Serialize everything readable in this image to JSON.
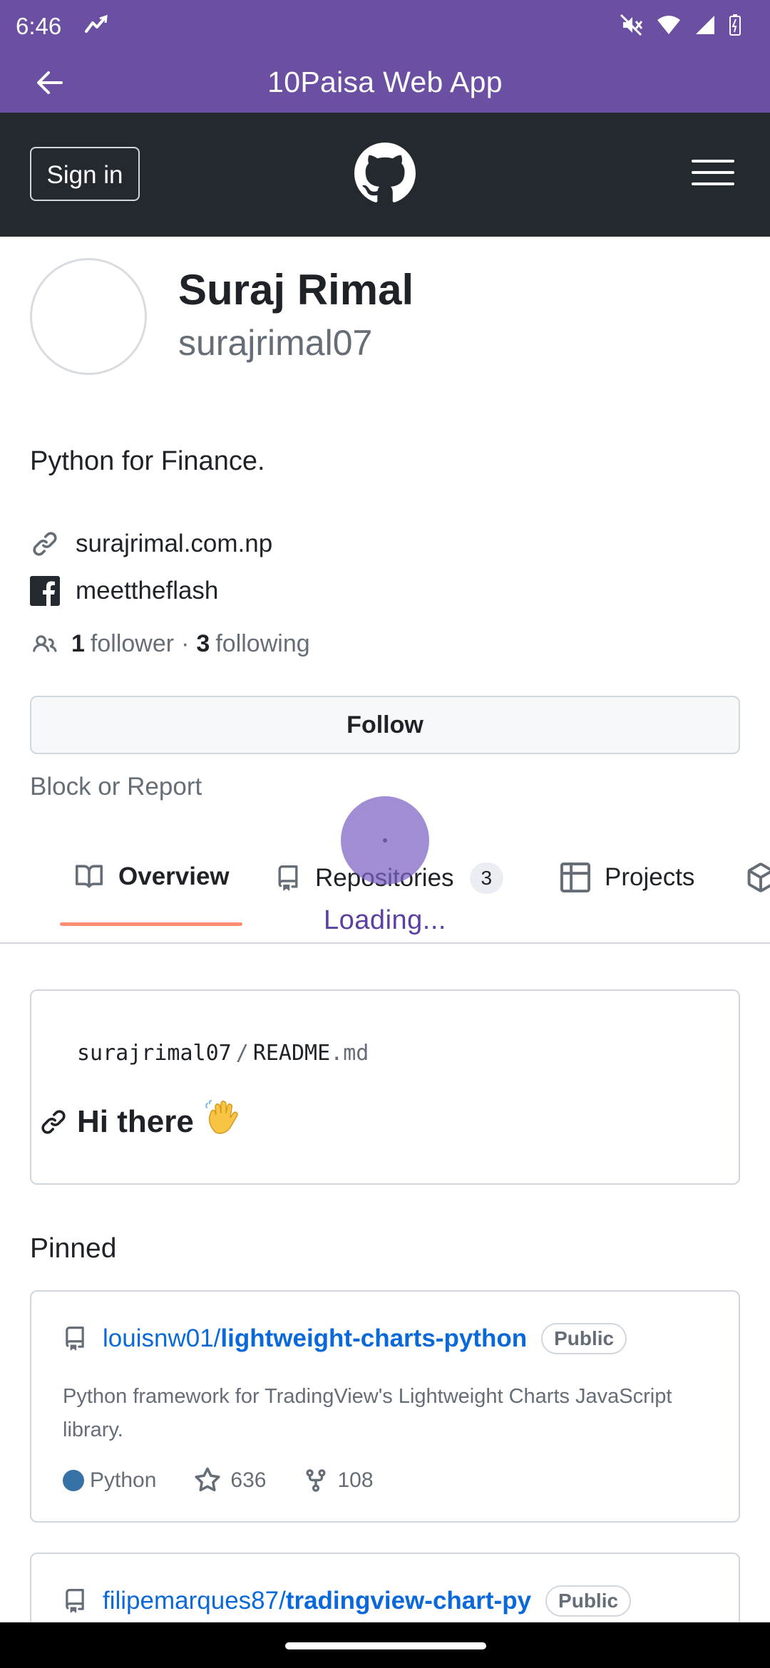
{
  "status_bar": {
    "time": "6:46"
  },
  "app_bar": {
    "title": "10Paisa Web App"
  },
  "gh_header": {
    "sign_in": "Sign in"
  },
  "profile": {
    "name": "Suraj Rimal",
    "username": "surajrimal07",
    "bio": "Python for Finance.",
    "website": "surajrimal.com.np",
    "facebook": "meettheflash",
    "followers_count": "1",
    "followers_label": "follower",
    "dot": "·",
    "following_count": "3",
    "following_label": "following",
    "follow_button": "Follow",
    "block_report": "Block or Report"
  },
  "tabs": [
    {
      "label": "Overview",
      "active": true
    },
    {
      "label": "Repositories",
      "count": "3"
    },
    {
      "label": "Projects"
    }
  ],
  "loading_text": "Loading...",
  "readme": {
    "owner": "surajrimal07",
    "separator": "/",
    "file": "README",
    "ext": ".md",
    "heading": "Hi there",
    "emoji": "wave-emoji"
  },
  "pinned": {
    "title": "Pinned",
    "repos": [
      {
        "owner": "louisnw01/",
        "name": "lightweight-charts-python",
        "visibility": "Public",
        "description": "Python framework for TradingView's Lightweight Charts JavaScript library.",
        "language": "Python",
        "language_color": "#3572a5",
        "stars": "636",
        "forks": "108"
      },
      {
        "owner": "filipemarques87/",
        "name": "tradingview-chart-py",
        "visibility": "Public"
      }
    ]
  },
  "colors": {
    "app_bar": "#6a4fa3",
    "gh_header": "#24292f",
    "link": "#0969da",
    "tab_underline": "#fd8c73"
  }
}
